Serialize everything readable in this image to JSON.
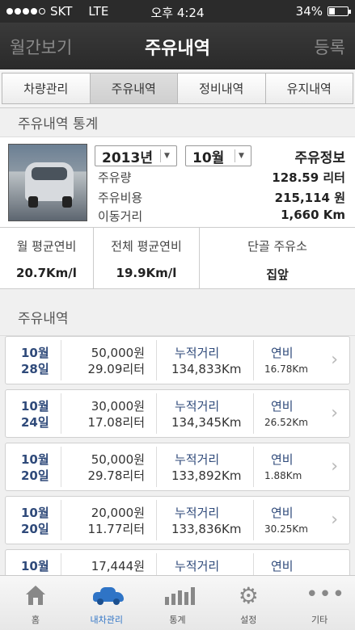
{
  "status": {
    "carrier": "SKT",
    "network": "LTE",
    "time": "오후 4:24",
    "battery": "34%",
    "battery_level": 0.34
  },
  "nav": {
    "left": "월간보기",
    "title": "주유내역",
    "right": "등록"
  },
  "tabs": [
    {
      "label": "차량관리"
    },
    {
      "label": "주유내역"
    },
    {
      "label": "정비내역"
    },
    {
      "label": "유지내역"
    }
  ],
  "stats_header": "주유내역 통계",
  "summary": {
    "year": "2013년",
    "month": "10월",
    "title": "주유정보",
    "rows": [
      {
        "label": "주유량",
        "value": "128.59 리터"
      },
      {
        "label": "주유비용",
        "value": "215,114 원"
      },
      {
        "label": "이동거리",
        "value": "1,660 Km"
      }
    ]
  },
  "averages": [
    {
      "label": "월 평균연비",
      "value": "20.7Km/l"
    },
    {
      "label": "전체 평균연비",
      "value": "19.9Km/l"
    },
    {
      "label": "단골 주유소",
      "value": "집앞"
    }
  ],
  "records_header": "주유내역",
  "records": [
    {
      "month": "10월",
      "day": "28일",
      "amount": "50,000원",
      "liters": "29.09리터",
      "dist_label": "누적거리",
      "dist": "134,833Km",
      "eff_label": "연비",
      "eff": "16.78Km"
    },
    {
      "month": "10월",
      "day": "24일",
      "amount": "30,000원",
      "liters": "17.08리터",
      "dist_label": "누적거리",
      "dist": "134,345Km",
      "eff_label": "연비",
      "eff": "26.52Km"
    },
    {
      "month": "10월",
      "day": "20일",
      "amount": "50,000원",
      "liters": "29.78리터",
      "dist_label": "누적거리",
      "dist": "133,892Km",
      "eff_label": "연비",
      "eff": "1.88Km"
    },
    {
      "month": "10월",
      "day": "20일",
      "amount": "20,000원",
      "liters": "11.77리터",
      "dist_label": "누적거리",
      "dist": "133,836Km",
      "eff_label": "연비",
      "eff": "30.25Km"
    },
    {
      "month": "10월",
      "day": "",
      "amount": "17,444원",
      "liters": "",
      "dist_label": "누적거리",
      "dist": "",
      "eff_label": "연비",
      "eff": ""
    }
  ],
  "bottom_nav": [
    {
      "label": "홈",
      "icon": "home-icon"
    },
    {
      "label": "내차관리",
      "icon": "car-icon"
    },
    {
      "label": "통계",
      "icon": "bar-chart-icon"
    },
    {
      "label": "설정",
      "icon": "gear-icon"
    },
    {
      "label": "기타",
      "icon": "more-icon"
    }
  ],
  "colors": {
    "accent": "#2f74c6",
    "date_text": "#2f4a7a",
    "navbar": "#2e2e2e"
  }
}
